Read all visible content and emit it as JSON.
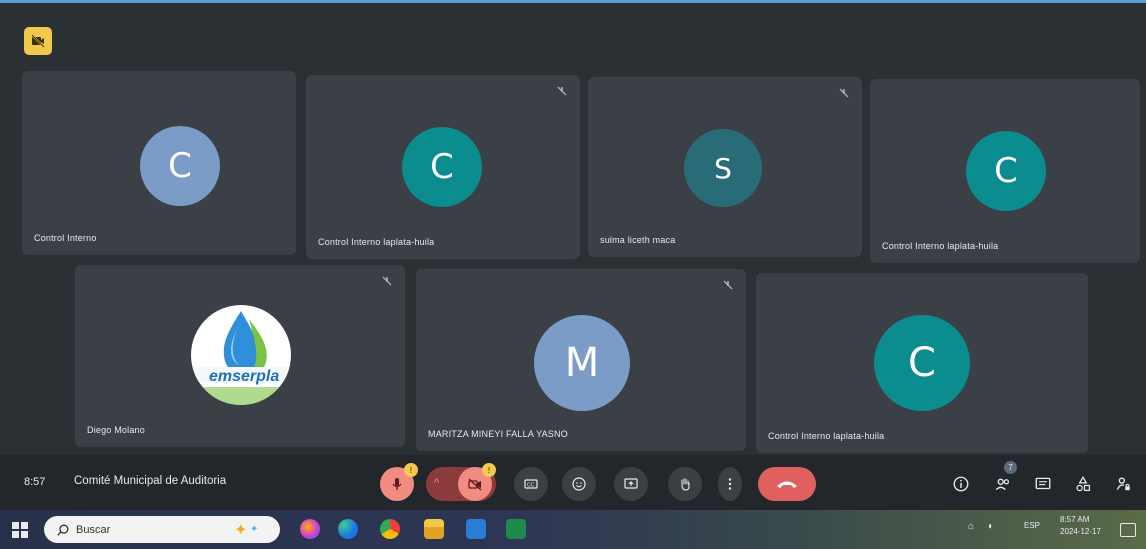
{
  "participants": [
    {
      "initial": "C",
      "name": "Control Interno",
      "color": "#7a9cc6"
    },
    {
      "initial": "C",
      "name": "Control Interno laplata-huila",
      "color": "#0b8c8f"
    },
    {
      "initial": "S",
      "name": "sulma liceth maca",
      "color": "#2a6b78"
    },
    {
      "initial": "C",
      "name": "Control Interno laplata-huila",
      "color": "#0b8c8f"
    },
    {
      "initial": "",
      "name": "Diego Molano",
      "logo_text": "emserpla",
      "color": "#ffffff"
    },
    {
      "initial": "M",
      "name": "MARITZA MINEYI FALLA YASNO",
      "color": "#7a9cc6"
    },
    {
      "initial": "C",
      "name": "Control Interno laplata-huila",
      "color": "#0b8c8f"
    }
  ],
  "controls": {
    "time": "8:57",
    "meeting_title": "Comité Municipal de Auditoria",
    "mic_badge": "!",
    "camera_badge": "!",
    "people_count": "7"
  },
  "taskbar": {
    "search_label": "Buscar",
    "tray_lang": "ESP",
    "tray_time": "8:57 AM",
    "tray_date": "2024-12-17"
  },
  "colors": {
    "accent_red": "#e06060",
    "camera_off": "#f28b82"
  }
}
